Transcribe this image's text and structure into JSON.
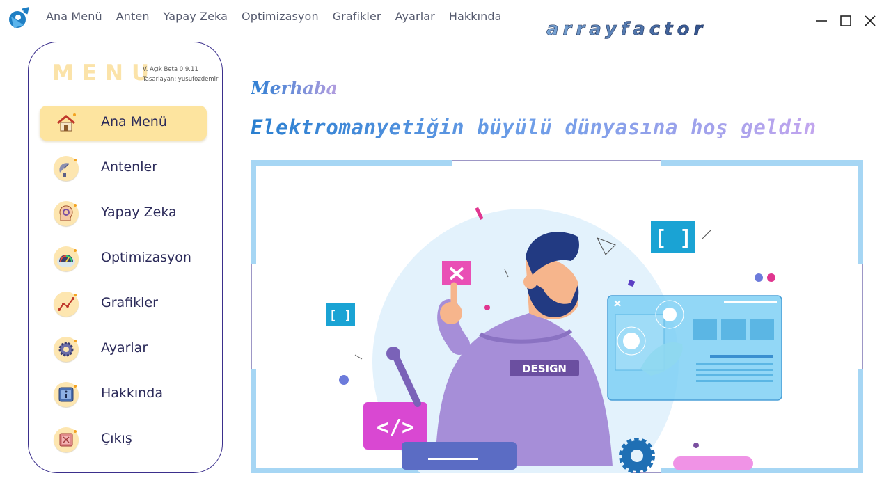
{
  "nav": {
    "items": [
      "Ana Menü",
      "Anten",
      "Yapay Zeka",
      "Optimizasyon",
      "Grafikler",
      "Ayarlar",
      "Hakkında"
    ]
  },
  "brand": {
    "text": "arrayfactor"
  },
  "window": {
    "icons": [
      "minimize-icon",
      "maximize-icon",
      "close-icon"
    ]
  },
  "sidebar": {
    "title": "MENU",
    "version": "V. Açık Beta 0.9.11",
    "designer": "Tasarlayan: yusufozdemir",
    "items": [
      {
        "label": "Ana Menü",
        "icon": "home-icon",
        "active": true
      },
      {
        "label": "Antenler",
        "icon": "satellite-dish-icon",
        "active": false
      },
      {
        "label": "Yapay Zeka",
        "icon": "brain-gear-icon",
        "active": false
      },
      {
        "label": "Optimizasyon",
        "icon": "gauge-icon",
        "active": false
      },
      {
        "label": "Grafikler",
        "icon": "line-graph-icon",
        "active": false
      },
      {
        "label": "Ayarlar",
        "icon": "gear-icon",
        "active": false
      },
      {
        "label": "Hakkında",
        "icon": "info-icon",
        "active": false
      },
      {
        "label": "Çıkış",
        "icon": "exit-icon",
        "active": false
      }
    ]
  },
  "main": {
    "greeting": "Merhaba",
    "welcome": "Elektromanyetiğin büyülü dünyasına hoş geldin",
    "illustration": {
      "shirt_text": "DESIGN"
    }
  },
  "colors": {
    "accent_yellow": "#fde49f",
    "sidebar_border": "#3b2f8c",
    "frame_blue": "#a6d6f4",
    "title_blue": "#2a7fd0",
    "title_lilac": "#c2a5ee"
  }
}
